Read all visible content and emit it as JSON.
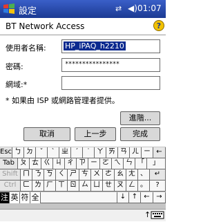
{
  "status_bar": {
    "title": "設定",
    "time": "01:07",
    "icons": [
      "windows-logo-icon",
      "connectivity-icon",
      "volume-icon"
    ]
  },
  "header": {
    "title": "BT Network Access",
    "help_icon": "?"
  },
  "form": {
    "username": {
      "label": "使用者名稱:",
      "value": "HP_iPAQ_h2210"
    },
    "password": {
      "label": "密碼:",
      "value": "****************"
    },
    "domain": {
      "label": "網域:*",
      "value": ""
    },
    "note": "* 如果由 ISP 或網路管理者提供。",
    "advanced_button": "進階..."
  },
  "nav_buttons": {
    "cancel": "取消",
    "back": "上一步",
    "finish": "完成"
  },
  "keyboard": {
    "rows": [
      [
        "Esc",
        "ㄅ",
        "ㄉ",
        "ˇ",
        "ˋ",
        "ㄓ",
        "ˊ",
        "˙",
        "ㄚ",
        "ㄞ",
        "ㄢ",
        "ㄦ",
        "ㄧ",
        "←"
      ],
      [
        "Tab",
        "ㄆ",
        "ㄊ",
        "ㄍ",
        "ㄐ",
        "ㄔ",
        "ㄗ",
        "ㄧ",
        "ㄛ",
        "ㄟ",
        "ㄣ",
        "「",
        "」"
      ],
      [
        "Shift",
        "ㄇ",
        "ㄋ",
        "ㄎ",
        "ㄑ",
        "ㄕ",
        "ㄘ",
        "ㄨ",
        "ㄜ",
        "ㄠ",
        "ㄤ",
        "、",
        "↵"
      ],
      [
        "Ctrl",
        "ㄈ",
        "ㄌ",
        "ㄏ",
        "ㄒ",
        "ㄖ",
        "ㄙ",
        "ㄩ",
        "ㄝ",
        "ㄡ",
        "ㄥ",
        "。",
        "?"
      ]
    ],
    "mode_keys": [
      "注",
      "英",
      "符",
      "全"
    ],
    "arrow_keys": [
      "↓",
      "↑",
      "←",
      "→"
    ]
  },
  "menu": {
    "keyboard_arrow": "↑",
    "sip_icon": "keyboard-icon"
  },
  "colors": {
    "title_bar": "#1b3a93",
    "selection": "#0b2a8f",
    "sip_bg": "#c4c4c4"
  }
}
